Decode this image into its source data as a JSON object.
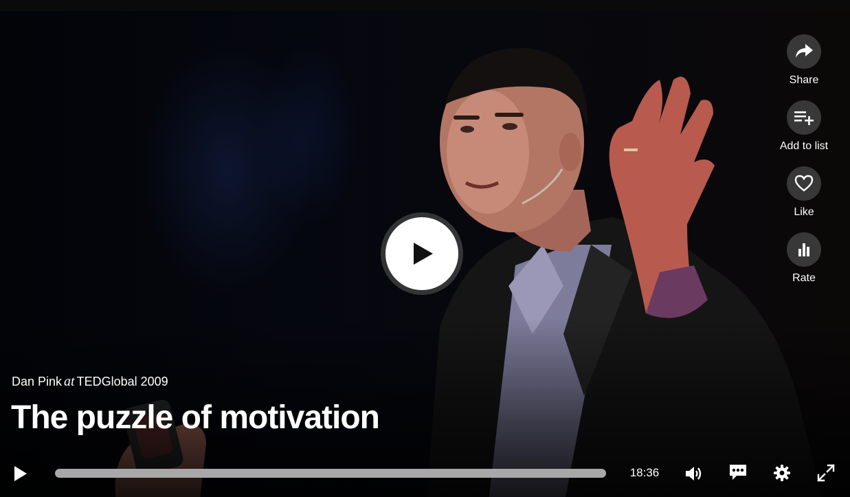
{
  "talk": {
    "speaker": "Dan Pink",
    "at": "at",
    "event": "TEDGlobal 2009",
    "title": "The puzzle of motivation"
  },
  "actions": [
    {
      "label": "Share",
      "icon": "share-icon"
    },
    {
      "label": "Add to list",
      "icon": "playlist-add-icon"
    },
    {
      "label": "Like",
      "icon": "heart-icon"
    },
    {
      "label": "Rate",
      "icon": "bar-chart-icon"
    }
  ],
  "player": {
    "duration": "18:36",
    "progress": 0,
    "accent": "#e62b1e"
  },
  "controls": {
    "icons": [
      "play-icon",
      "volume-icon",
      "subtitles-icon",
      "gear-icon",
      "fullscreen-icon"
    ]
  }
}
